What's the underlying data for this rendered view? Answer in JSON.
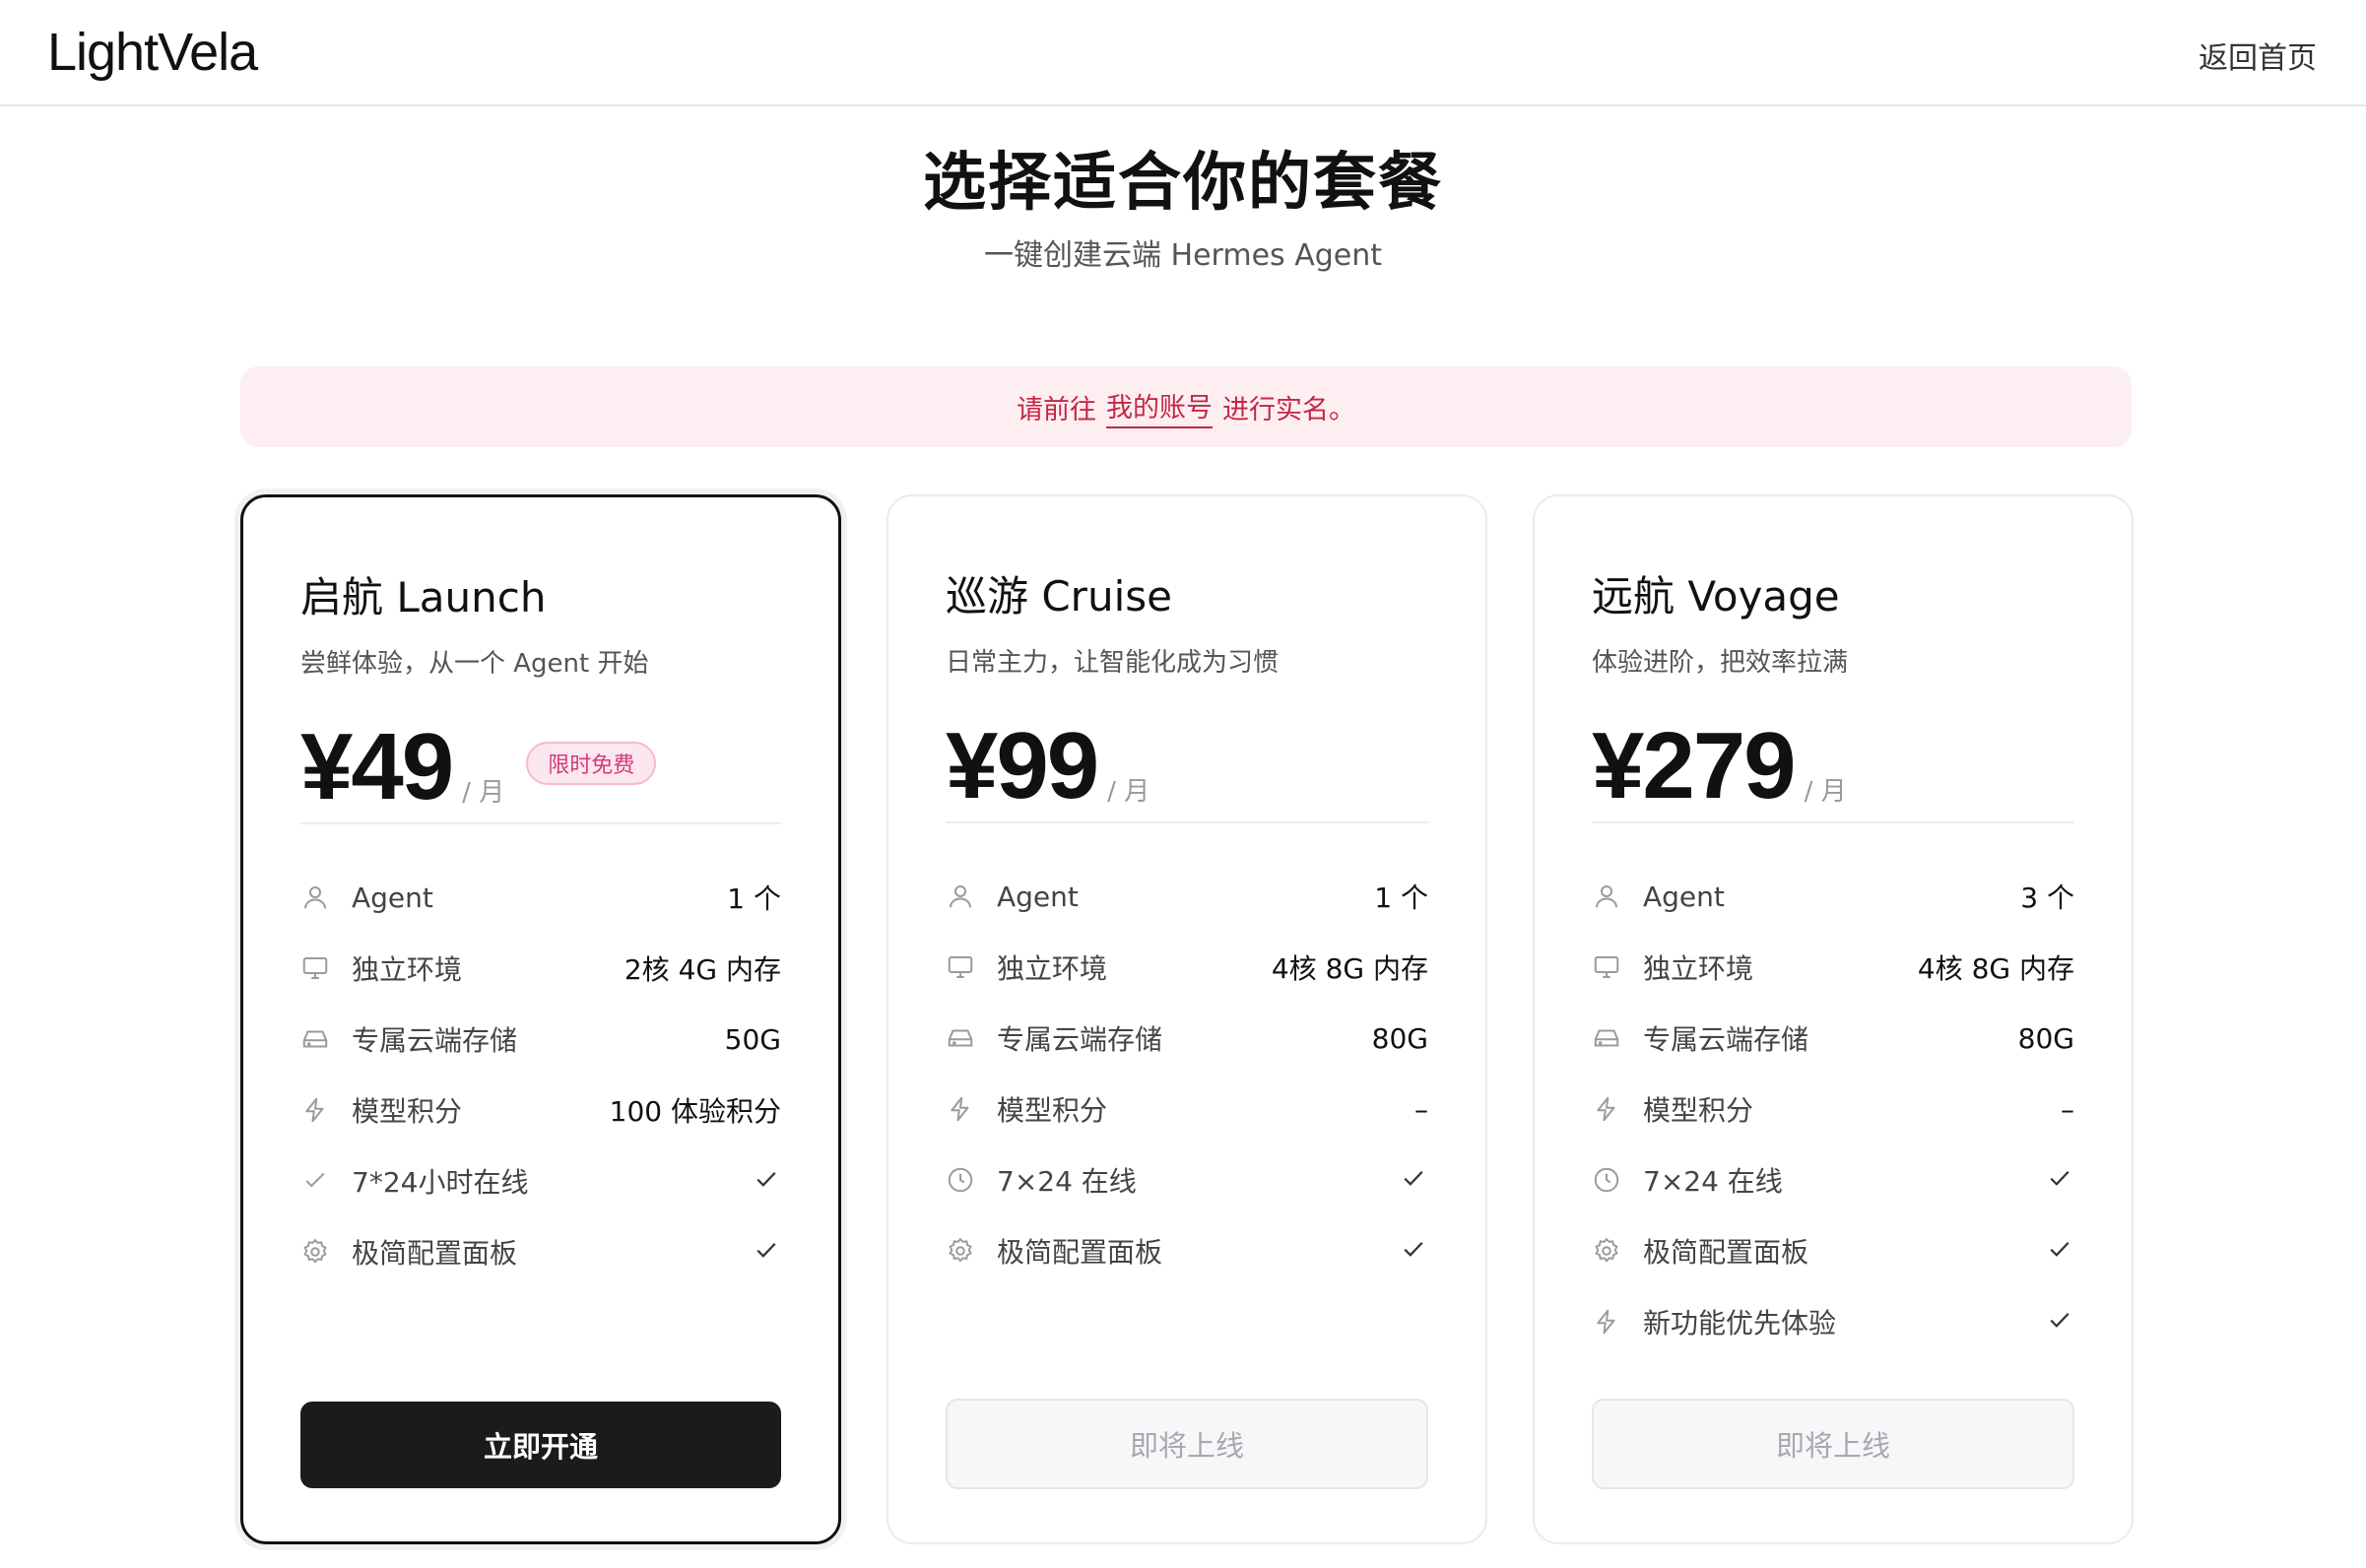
{
  "header": {
    "logo": "LightVela",
    "back_label": "返回首页"
  },
  "hero": {
    "title": "选择适合你的套餐",
    "subtitle": "一键创建云端 Hermes Agent"
  },
  "notice": {
    "before": "请前往",
    "link": "我的账号",
    "after": "进行实名。"
  },
  "plans": [
    {
      "name": "启航 Launch",
      "desc": "尝鲜体验，从一个 Agent 开始",
      "price": "¥49",
      "per": "/ 月",
      "badge": "限时免费",
      "features": [
        {
          "icon": "user-icon",
          "label": "Agent",
          "value": "1 个"
        },
        {
          "icon": "monitor-icon",
          "label": "独立环境",
          "value": "2核 4G 内存"
        },
        {
          "icon": "drive-icon",
          "label": "专属云端存储",
          "value": "50G"
        },
        {
          "icon": "bolt-icon",
          "label": "模型积分",
          "value": "100 体验积分"
        },
        {
          "icon": "check-small-icon",
          "label": "7*24小时在线",
          "value": "check"
        },
        {
          "icon": "gear-icon",
          "label": "极简配置面板",
          "value": "check"
        }
      ],
      "cta": "立即开通"
    },
    {
      "name": "巡游 Cruise",
      "desc": "日常主力，让智能化成为习惯",
      "price": "¥99",
      "per": "/ 月",
      "features": [
        {
          "icon": "user-icon",
          "label": "Agent",
          "value": "1 个"
        },
        {
          "icon": "monitor-icon",
          "label": "独立环境",
          "value": "4核 8G 内存"
        },
        {
          "icon": "drive-icon",
          "label": "专属云端存储",
          "value": "80G"
        },
        {
          "icon": "bolt-icon",
          "label": "模型积分",
          "value": "–"
        },
        {
          "icon": "clock-icon",
          "label": "7×24 在线",
          "value": "check"
        },
        {
          "icon": "gear-icon",
          "label": "极简配置面板",
          "value": "check"
        }
      ],
      "cta": "即将上线"
    },
    {
      "name": "远航 Voyage",
      "desc": "体验进阶，把效率拉满",
      "price": "¥279",
      "per": "/ 月",
      "features": [
        {
          "icon": "user-icon",
          "label": "Agent",
          "value": "3 个"
        },
        {
          "icon": "monitor-icon",
          "label": "独立环境",
          "value": "4核 8G 内存"
        },
        {
          "icon": "drive-icon",
          "label": "专属云端存储",
          "value": "80G"
        },
        {
          "icon": "bolt-icon",
          "label": "模型积分",
          "value": "–"
        },
        {
          "icon": "clock-icon",
          "label": "7×24 在线",
          "value": "check"
        },
        {
          "icon": "gear-icon",
          "label": "极简配置面板",
          "value": "check"
        },
        {
          "icon": "bolt-icon",
          "label": "新功能优先体验",
          "value": "check"
        }
      ],
      "cta": "即将上线"
    }
  ]
}
